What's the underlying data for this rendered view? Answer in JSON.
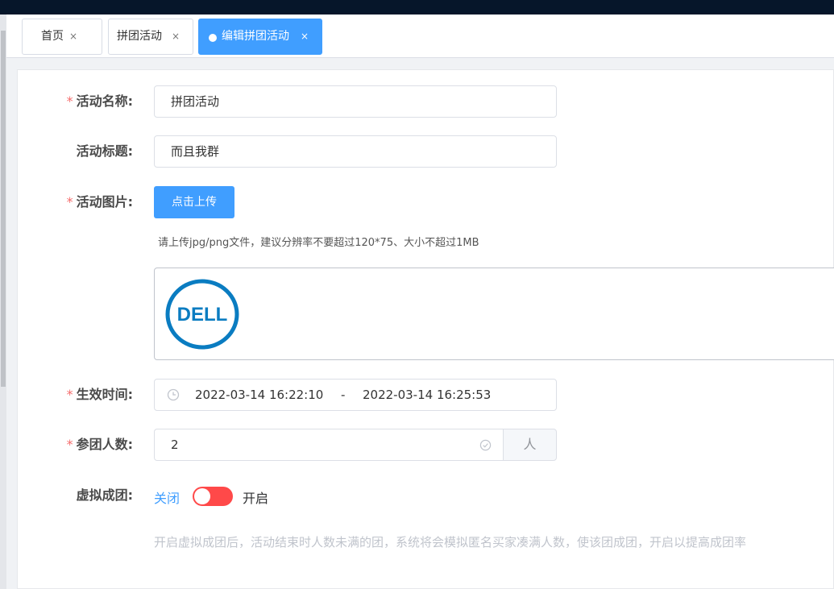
{
  "tabs": [
    {
      "label": "首页",
      "close": "×"
    },
    {
      "label": "拼团活动",
      "close": "×"
    },
    {
      "label": "编辑拼团活动",
      "close": "×"
    }
  ],
  "form": {
    "required_mark": "*",
    "name": {
      "label": "活动名称:",
      "value": "拼团活动"
    },
    "title": {
      "label": "活动标题:",
      "value": "而且我群"
    },
    "image": {
      "label": "活动图片:",
      "upload_button": "点击上传",
      "hint": "请上传jpg/png文件，建议分辨率不要超过120*75、大小不超过1MB",
      "logo_text": "DELL"
    },
    "time": {
      "label": "生效时间:",
      "start": "2022-03-14 16:22:10",
      "separator": "-",
      "end": "2022-03-14 16:25:53"
    },
    "people": {
      "label": "参团人数:",
      "value": "2",
      "unit": "人"
    },
    "virtual": {
      "label": "虚拟成团:",
      "off_label": "关闭",
      "on_label": "开启",
      "tip": "开启虚拟成团后，活动结束时人数未满的团，系统将会模拟匿名买家凑满人数，使该团成团，开启以提高成团率"
    }
  },
  "colors": {
    "primary": "#409eff",
    "danger": "#f56c6c",
    "switch_off": "#ff4949",
    "topbar": "#06162a"
  }
}
